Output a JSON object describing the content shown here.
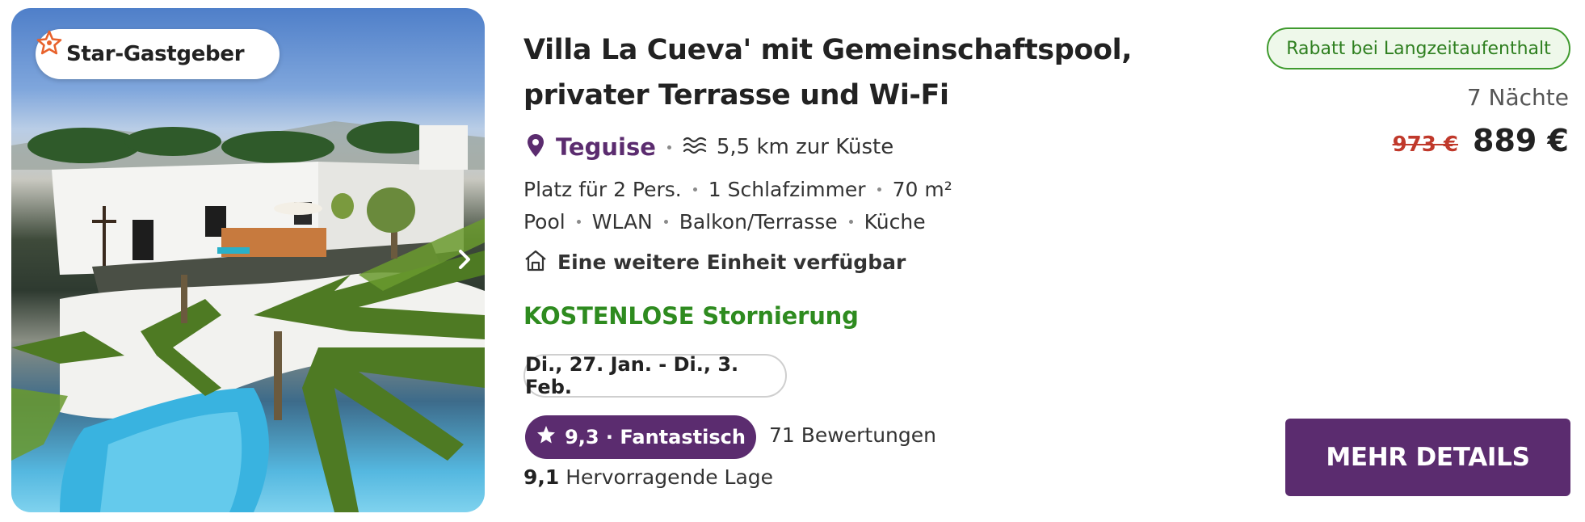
{
  "photo": {
    "alt_icon": "listing-photo",
    "badge": {
      "icon": "star-host-icon",
      "label": "Star-Gastgeber"
    },
    "next_icon": "chevron-right-icon"
  },
  "listing": {
    "title": "Villa La Cueva' mit Gemeinschaftspool, privater Terrasse und Wi-Fi",
    "location": {
      "icon": "map-pin-icon",
      "city": "Teguise",
      "coast_icon": "waves-icon",
      "coast_distance": "5,5 km zur Küste"
    },
    "facts_row1": [
      "Platz für 2 Pers.",
      "1 Schlafzimmer",
      "70 m²"
    ],
    "facts_row2": [
      "Pool",
      "WLAN",
      "Balkon/Terrasse",
      "Küche"
    ],
    "units": {
      "icon": "house-icon",
      "text": "Eine weitere Einheit verfügbar"
    },
    "cancellation": "KOSTENLOSE Stornierung",
    "dates": "Di., 27. Jan. - Di., 3. Feb.",
    "rating": {
      "icon": "star-icon",
      "label": "9,3 · Fantastisch"
    },
    "reviews": "71 Bewertungen",
    "location_score": {
      "value": "9,1",
      "label": "Hervorragende Lage"
    }
  },
  "pricing": {
    "badge": "Rabatt bei Langzeitaufenthalt",
    "nights": "7 Nächte",
    "old_price": "973 €",
    "new_price": "889 €",
    "cta": "MEHR DETAILS"
  },
  "colors": {
    "brand_purple": "#5b2c6f",
    "success_green": "#2e8b1f",
    "strike_red": "#c0392b",
    "host_orange": "#e8622c"
  }
}
